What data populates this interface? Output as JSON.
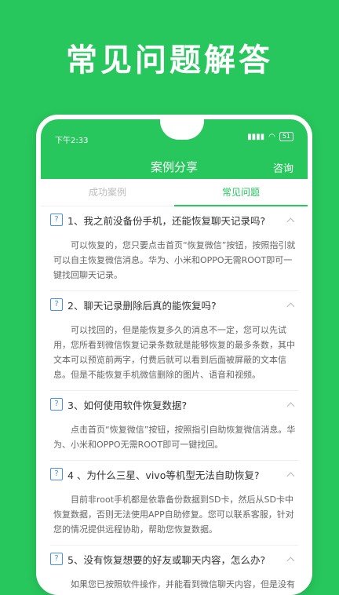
{
  "headline": "常见问题解答",
  "status_bar": {
    "time": "下午2:33",
    "signal": "▮▮▮▮",
    "wifi": "◠",
    "battery": "51"
  },
  "nav": {
    "title": "案例分享",
    "action": "咨询"
  },
  "tabs": [
    {
      "label": "成功案例"
    },
    {
      "label": "常见问题"
    }
  ],
  "faq": [
    {
      "question": "1、我之前没备份手机，还能恢复聊天记录吗?",
      "answer": "可以恢复的，您只要点击首页“恢复微信”按钮，按照指引就可以自主恢复微信消息。华为、小米和OPPO无需ROOT即可一键找回聊天记录。"
    },
    {
      "question": "2、聊天记录删除后真的能恢复吗?",
      "answer": "可以找回的，但是能恢复多久的消息不一定，您可以先试用，您所看到微信恢复记录条数就是能够恢复的最多条数，其中文本可以预览前两字，付费后就可以看到后面被屏蔽的文本信息。但是不能恢复手机微信删除的图片、语音和视频。"
    },
    {
      "question": "3、如何使用软件恢复数据?",
      "answer": "点击首页“恢复微信”按钮，按照指引自助恢复微信消息。华为、小米和OPPO无需ROOT即可一键找回。"
    },
    {
      "question": "4 、为什么三星、vivo等机型无法自助恢复?",
      "answer": "目前非root手机都是依靠备份数据到SD卡，然后从SD卡中恢复数据，否则无法使用APP自助修复。您可以联系客服，针对您的情况提供远程协助，帮助您恢复数据。"
    },
    {
      "question": "5、没有恢复想要的好友或聊天内容，怎么办?",
      "answer": "如果您已按照软件操作，并能看到微信聊天内容，但是没有您想要的信息，说明已经被彻底删除，购买也是无法恢复"
    }
  ]
}
